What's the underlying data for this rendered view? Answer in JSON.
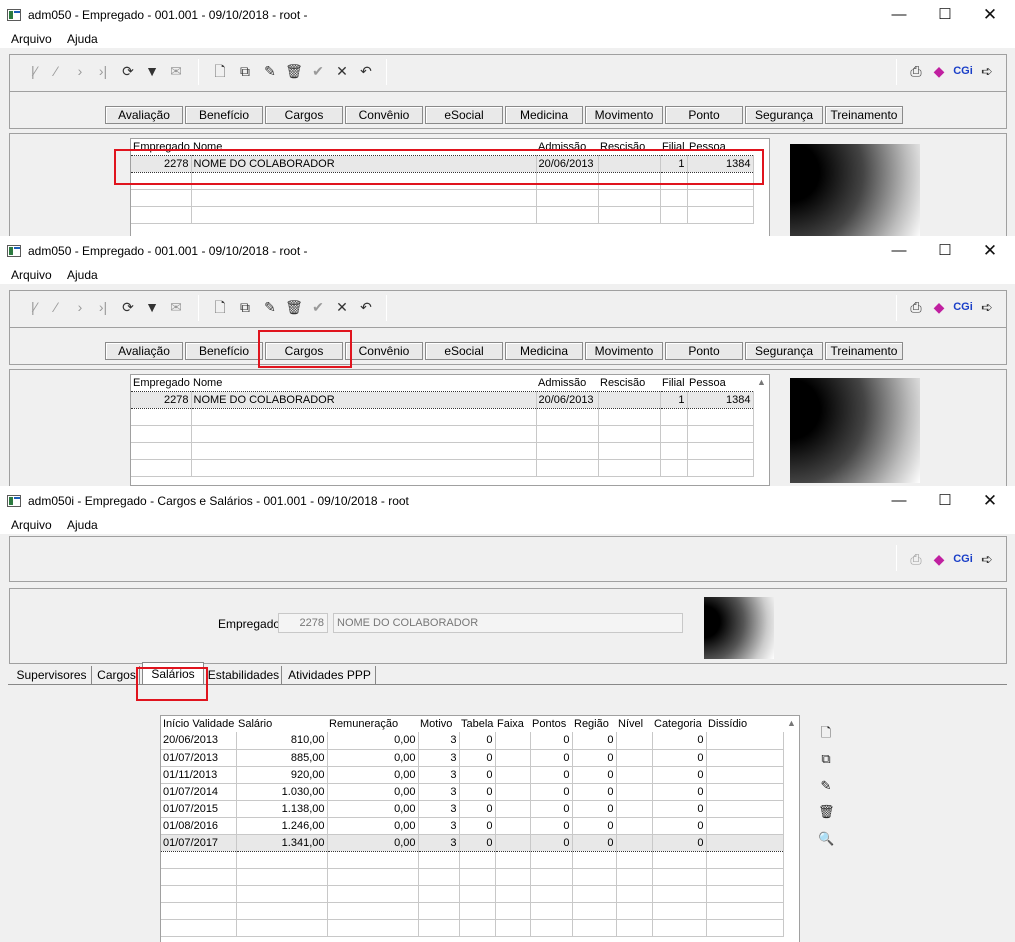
{
  "win1": {
    "title": "adm050 - Empregado - 001.001 - 09/10/2018 - root -",
    "menu": [
      "Arquivo",
      "Ajuda"
    ],
    "modules": [
      "Avaliação",
      "Benefício",
      "Cargos",
      "Convênio",
      "eSocial",
      "Medicina",
      "Movimento",
      "Ponto",
      "Segurança",
      "Treinamento"
    ],
    "grid_headers": [
      "Empregado",
      "Nome",
      "Admissão",
      "Rescisão",
      "Filial",
      "Pessoa"
    ],
    "row": {
      "empregado": "2278",
      "nome": "NOME DO COLABORADOR",
      "admissao": "20/06/2013",
      "rescisao": "",
      "filial": "1",
      "pessoa": "1384"
    }
  },
  "win2": {
    "title": "adm050 - Empregado - 001.001 - 09/10/2018 - root -",
    "menu": [
      "Arquivo",
      "Ajuda"
    ],
    "modules": [
      "Avaliação",
      "Benefício",
      "Cargos",
      "Convênio",
      "eSocial",
      "Medicina",
      "Movimento",
      "Ponto",
      "Segurança",
      "Treinamento"
    ],
    "grid_headers": [
      "Empregado",
      "Nome",
      "Admissão",
      "Rescisão",
      "Filial",
      "Pessoa"
    ],
    "row": {
      "empregado": "2278",
      "nome": "NOME DO COLABORADOR",
      "admissao": "20/06/2013",
      "rescisao": "",
      "filial": "1",
      "pessoa": "1384"
    }
  },
  "win3": {
    "title": "adm050i - Empregado - Cargos e Salários - 001.001 - 09/10/2018 - root",
    "menu": [
      "Arquivo",
      "Ajuda"
    ],
    "empregado_label": "Empregado:",
    "empregado_code": "2278",
    "empregado_name": "NOME DO COLABORADOR",
    "tabs": [
      "Supervisores",
      "Cargos",
      "Salários",
      "Estabilidades",
      "Atividades PPP"
    ],
    "active_tab": "Salários",
    "headers": [
      "Início Validade",
      "Salário",
      "Remuneração",
      "Motivo",
      "Tabela",
      "Faixa",
      "Pontos",
      "Região",
      "Nível",
      "Categoria",
      "Dissídio"
    ],
    "rows": [
      [
        "20/06/2013",
        "810,00",
        "0,00",
        "3",
        "0",
        "",
        "0",
        "0",
        "",
        "0",
        ""
      ],
      [
        "01/07/2013",
        "885,00",
        "0,00",
        "3",
        "0",
        "",
        "0",
        "0",
        "",
        "0",
        ""
      ],
      [
        "01/11/2013",
        "920,00",
        "0,00",
        "3",
        "0",
        "",
        "0",
        "0",
        "",
        "0",
        ""
      ],
      [
        "01/07/2014",
        "1.030,00",
        "0,00",
        "3",
        "0",
        "",
        "0",
        "0",
        "",
        "0",
        ""
      ],
      [
        "01/07/2015",
        "1.138,00",
        "0,00",
        "3",
        "0",
        "",
        "0",
        "0",
        "",
        "0",
        ""
      ],
      [
        "01/08/2016",
        "1.246,00",
        "0,00",
        "3",
        "0",
        "",
        "0",
        "0",
        "",
        "0",
        ""
      ],
      [
        "01/07/2017",
        "1.341,00",
        "0,00",
        "3",
        "0",
        "",
        "0",
        "0",
        "",
        "0",
        ""
      ]
    ]
  },
  "toolbar_icons": [
    "first-icon",
    "prev-icon",
    "next-icon",
    "last-icon",
    "refresh-icon",
    "filter-icon",
    "search-icon",
    "new-icon",
    "copy-icon",
    "edit-icon",
    "delete-icon",
    "confirm-icon",
    "cancel-icon",
    "undo-icon",
    "print-icon",
    "report-icon",
    "cgi-icon",
    "exit-icon"
  ],
  "cgi_text": "CGi",
  "colors": {
    "highlight_border": "#e0141e",
    "window_bg": "#f0f0f0",
    "cgi_blue": "#1a3fc8"
  }
}
